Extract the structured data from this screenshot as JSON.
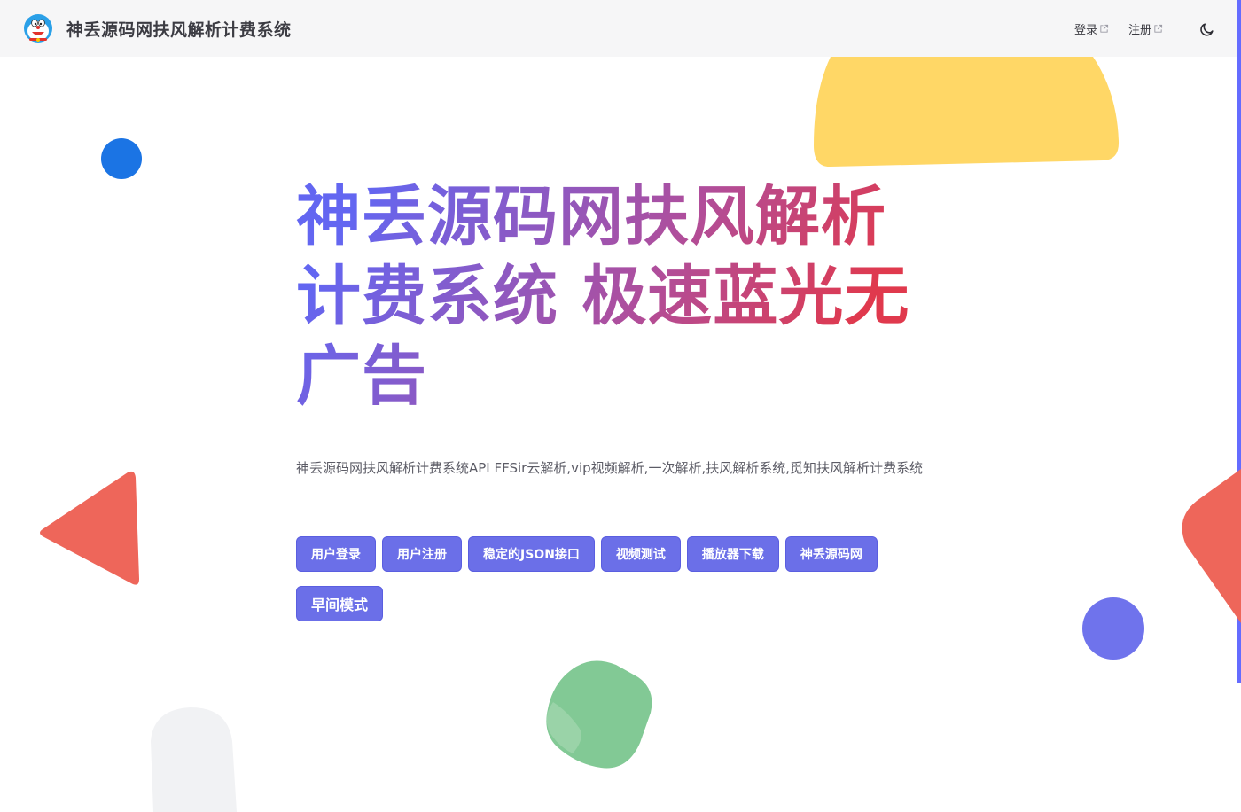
{
  "navbar": {
    "title": "神丢源码网扶风解析计费系统",
    "links": [
      {
        "label": "登录"
      },
      {
        "label": "注册"
      }
    ]
  },
  "hero": {
    "title": "神丢源码网扶风解析计费系统 极速蓝光无广告",
    "description": "神丢源码网扶风解析计费系统API FFSir云解析,vip视频解析,一次解析,扶风解析系统,觅知扶风解析计费系统",
    "actions": [
      {
        "label": "用户登录"
      },
      {
        "label": "用户注册"
      },
      {
        "label": "稳定的JSON接口"
      },
      {
        "label": "视频测试"
      },
      {
        "label": "播放器下载"
      },
      {
        "label": "神丢源码网"
      },
      {
        "label": "早间模式"
      }
    ]
  },
  "colors": {
    "brand": "#646cff",
    "button": "#6b6fe8",
    "yellow": "#ffd766",
    "red": "#ee665a",
    "blue": "#1b74e4",
    "green": "#82c995",
    "grey": "#f1f2f4"
  },
  "icons": {
    "logo": "doraemon-logo-icon",
    "external": "external-link-icon",
    "theme": "moon-icon"
  }
}
